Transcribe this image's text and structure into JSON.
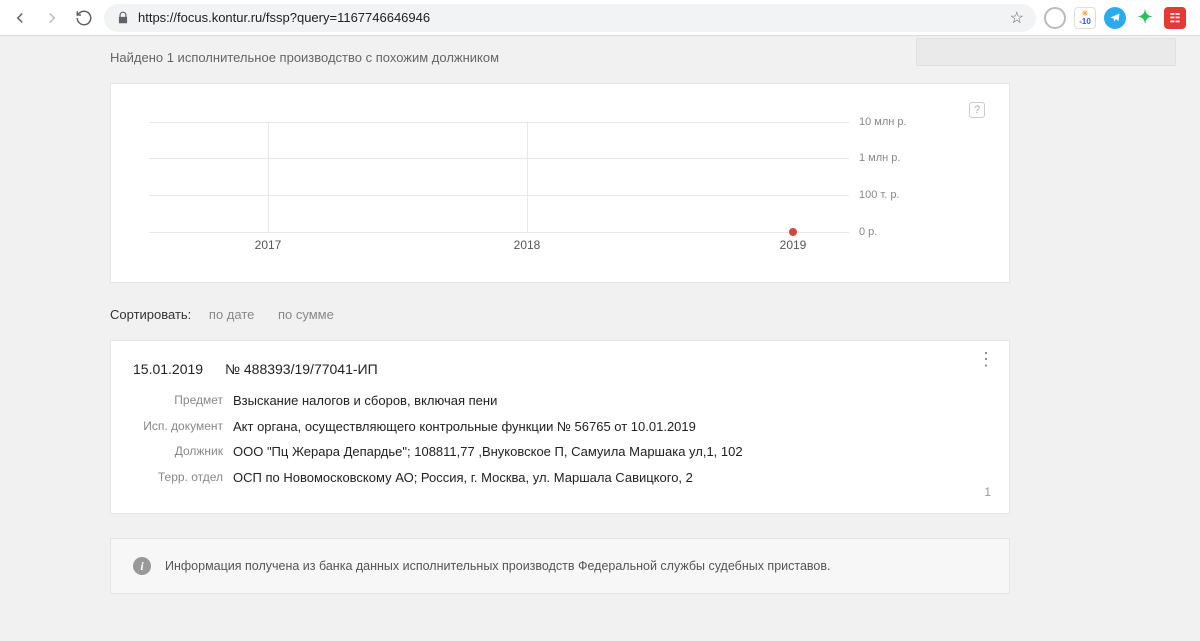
{
  "browser": {
    "url": "https://focus.kontur.ru/fssp?query=1167746646946",
    "star": "☆"
  },
  "ext": {
    "a": "",
    "b": "-10",
    "c": "",
    "d": "",
    "e": ""
  },
  "found_text": "Найдено 1 исполнительное производство с похожим должником",
  "chart_data": {
    "type": "line",
    "x": [
      "2017",
      "2018",
      "2019"
    ],
    "points": [
      {
        "x": "2019",
        "y": 0
      }
    ],
    "ylabels": [
      "10 млн р.",
      "1 млн р.",
      "100 т. р.",
      "0 р."
    ],
    "title": "",
    "xlabel": "",
    "ylabel": "",
    "ylim": [
      0,
      10000000
    ]
  },
  "sort": {
    "label": "Сортировать:",
    "by_date": "по дате",
    "by_sum": "по сумме"
  },
  "result": {
    "date": "15.01.2019",
    "number": "№ 488393/19/77041-ИП",
    "subject_k": "Предмет",
    "subject_v": "Взыскание налогов и сборов, включая пени",
    "doc_k": "Исп. документ",
    "doc_v": "Акт органа, осуществляющего контрольные функции № 56765 от 10.01.2019",
    "debtor_k": "Должник",
    "debtor_v": "ООО \"Пц Жерара Депардье\"; 108811,77 ,Внуковское П, Самуила Маршака ул,1, 102",
    "dept_k": "Терр. отдел",
    "dept_v": "ОСП по Новомосковскому АО; Россия, г. Москва, ул. Маршала Савицкого, 2",
    "index": "1"
  },
  "info": "Информация получена из банка данных исполнительных производств Федеральной службы судебных приставов."
}
